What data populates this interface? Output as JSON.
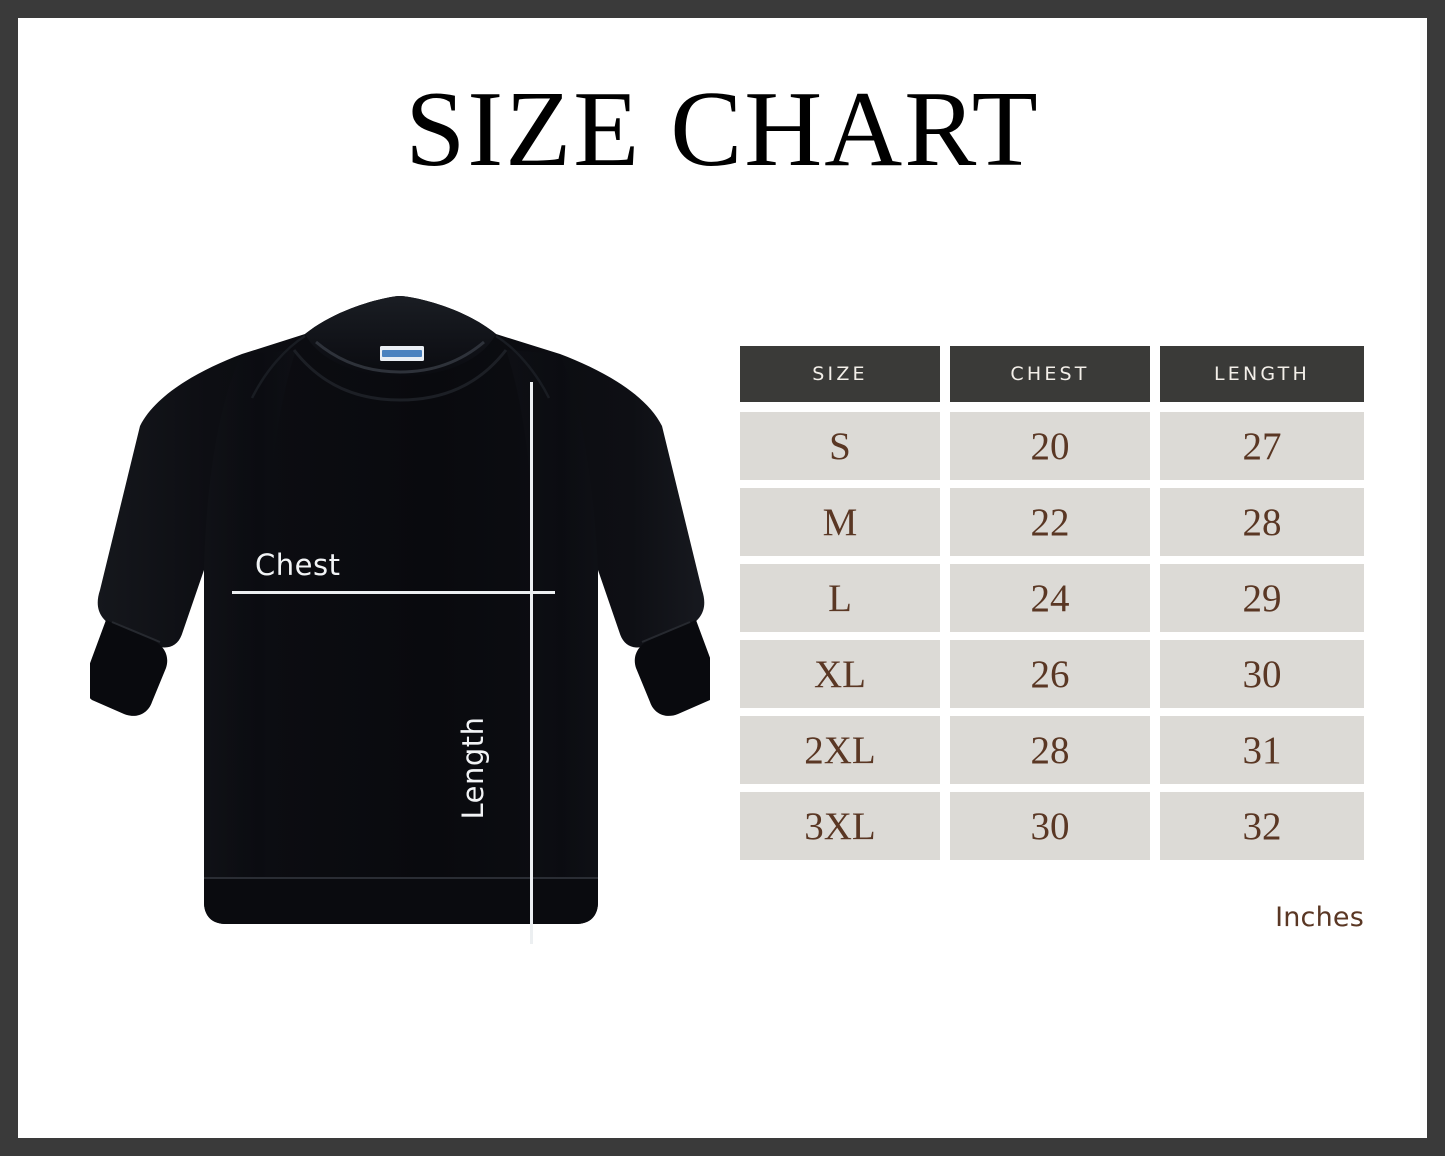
{
  "header": {
    "title": "SIZE CHART"
  },
  "colors": {
    "frame": "#3a3a3a",
    "background": "#ffffff",
    "header_cell": "#3a3a38",
    "header_text": "#f3efe9",
    "data_cell": "#dcdad6",
    "data_text": "#5a3724",
    "measure_line": "#eceff1",
    "garment": "#0b0c10"
  },
  "garment": {
    "name": "crewneck-sweatshirt",
    "color_name": "black",
    "measurements": {
      "chest_label": "Chest",
      "length_label": "Length"
    },
    "brand_tag": ""
  },
  "table": {
    "columns": [
      "SIZE",
      "CHEST",
      "LENGTH"
    ],
    "rows": [
      {
        "size": "S",
        "chest": "20",
        "length": "27"
      },
      {
        "size": "M",
        "chest": "22",
        "length": "28"
      },
      {
        "size": "L",
        "chest": "24",
        "length": "29"
      },
      {
        "size": "XL",
        "chest": "26",
        "length": "30"
      },
      {
        "size": "2XL",
        "chest": "28",
        "length": "31"
      },
      {
        "size": "3XL",
        "chest": "30",
        "length": "32"
      }
    ],
    "units": "Inches"
  },
  "chart_data": {
    "type": "table",
    "title": "SIZE CHART",
    "units": "Inches",
    "categories": [
      "S",
      "M",
      "L",
      "XL",
      "2XL",
      "3XL"
    ],
    "columns": [
      "SIZE",
      "CHEST",
      "LENGTH"
    ],
    "series": [
      {
        "name": "CHEST",
        "values": [
          20,
          22,
          24,
          26,
          28,
          30
        ]
      },
      {
        "name": "LENGTH",
        "values": [
          27,
          28,
          29,
          30,
          31,
          32
        ]
      }
    ],
    "xlabel": "SIZE",
    "ylabel": "Inches",
    "grid": false,
    "legend": "none"
  }
}
